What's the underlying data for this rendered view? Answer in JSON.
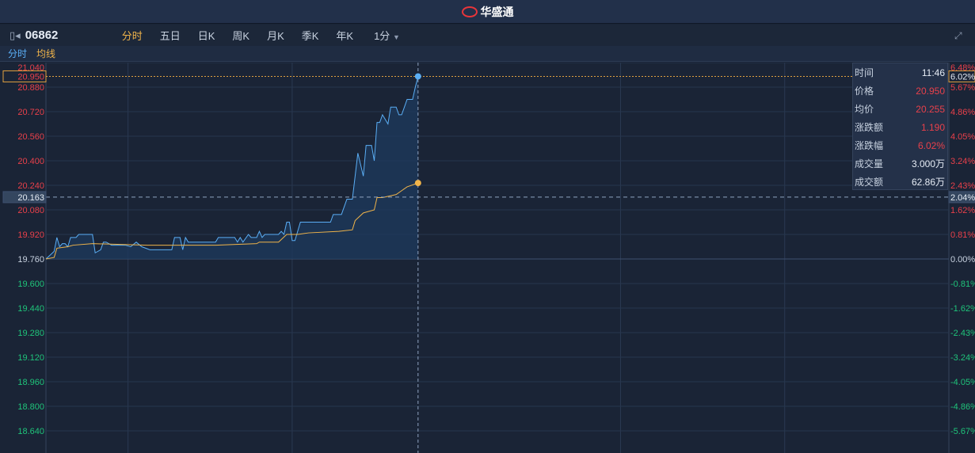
{
  "app": {
    "logo": "华盛通"
  },
  "toolbar": {
    "code": "06862",
    "tabs": [
      "分时",
      "五日",
      "日K",
      "周K",
      "月K",
      "季K",
      "年K"
    ],
    "active_tab": "分时",
    "interval": "1分"
  },
  "subbar": {
    "series": "分时",
    "avg": "均线"
  },
  "info": {
    "rows": [
      {
        "label": "时间",
        "value": "11:46"
      },
      {
        "label": "价格",
        "value": "20.950"
      },
      {
        "label": "均价",
        "value": "20.255"
      },
      {
        "label": "涨跌额",
        "value": "1.190"
      },
      {
        "label": "涨跌幅",
        "value": "6.02%"
      },
      {
        "label": "成交量",
        "value": "3.000万"
      },
      {
        "label": "成交额",
        "value": "62.86万"
      }
    ]
  },
  "colors": {
    "price": "#5aaef5",
    "avg": "#f0b44a",
    "up": "#e8404a",
    "down": "#1fc37a"
  },
  "chart_data": {
    "type": "line",
    "prev_close": 19.76,
    "ylim": [
      18.56,
      21.04
    ],
    "x_minutes_total": 330,
    "y_ticks": [
      "21.040",
      "20.880",
      "20.720",
      "20.560",
      "20.400",
      "20.240",
      "20.080",
      "19.920",
      "19.760",
      "19.600",
      "19.440",
      "19.280",
      "19.120",
      "18.960",
      "18.800",
      "18.640"
    ],
    "pct_ticks": [
      "6.48%",
      "5.67%",
      "4.86%",
      "4.05%",
      "3.24%",
      "2.43%",
      "1.62%",
      "0.81%",
      "0.00%",
      "-0.81%",
      "-1.62%",
      "-2.43%",
      "-3.24%",
      "-4.05%",
      "-4.86%",
      "-5.67%"
    ],
    "cursor": {
      "minute": 136,
      "price_label": "20.950",
      "pct_label": "6.02%"
    },
    "hline": {
      "price": 20.163,
      "price_label": "20.163",
      "pct_label": "2.04%"
    },
    "series": [
      {
        "name": "分时",
        "points": [
          [
            0,
            19.76
          ],
          [
            3,
            19.81
          ],
          [
            4,
            19.9
          ],
          [
            5,
            19.84
          ],
          [
            6,
            19.86
          ],
          [
            7,
            19.86
          ],
          [
            8,
            19.84
          ],
          [
            9,
            19.9
          ],
          [
            11,
            19.9
          ],
          [
            12,
            19.92
          ],
          [
            17,
            19.92
          ],
          [
            18,
            19.8
          ],
          [
            20,
            19.82
          ],
          [
            21,
            19.87
          ],
          [
            22,
            19.87
          ],
          [
            24,
            19.85
          ],
          [
            29,
            19.85
          ],
          [
            31,
            19.84
          ],
          [
            33,
            19.87
          ],
          [
            35,
            19.84
          ],
          [
            38,
            19.82
          ],
          [
            46,
            19.82
          ],
          [
            47,
            19.9
          ],
          [
            49,
            19.9
          ],
          [
            50,
            19.82
          ],
          [
            51,
            19.9
          ],
          [
            52,
            19.87
          ],
          [
            62,
            19.87
          ],
          [
            63,
            19.9
          ],
          [
            69,
            19.9
          ],
          [
            70,
            19.87
          ],
          [
            71,
            19.9
          ],
          [
            72,
            19.87
          ],
          [
            74,
            19.92
          ],
          [
            75,
            19.9
          ],
          [
            77,
            19.9
          ],
          [
            78,
            19.94
          ],
          [
            79,
            19.9
          ],
          [
            80,
            19.92
          ],
          [
            85,
            19.92
          ],
          [
            86,
            19.94
          ],
          [
            87,
            19.92
          ],
          [
            88,
            20.0
          ],
          [
            89,
            20.0
          ],
          [
            90,
            19.88
          ],
          [
            91,
            19.88
          ],
          [
            93,
            20.0
          ],
          [
            104,
            20.0
          ],
          [
            105,
            20.05
          ],
          [
            108,
            20.05
          ],
          [
            110,
            20.15
          ],
          [
            112,
            20.15
          ],
          [
            114,
            20.45
          ],
          [
            116,
            20.3
          ],
          [
            117,
            20.5
          ],
          [
            119,
            20.5
          ],
          [
            120,
            20.4
          ],
          [
            121,
            20.65
          ],
          [
            122,
            20.65
          ],
          [
            123,
            20.7
          ],
          [
            125,
            20.64
          ],
          [
            126,
            20.75
          ],
          [
            128,
            20.75
          ],
          [
            129,
            20.7
          ],
          [
            130,
            20.7
          ],
          [
            132,
            20.8
          ],
          [
            134,
            20.8
          ],
          [
            135,
            20.88
          ],
          [
            136,
            20.95
          ]
        ]
      },
      {
        "name": "均线",
        "points": [
          [
            0,
            19.76
          ],
          [
            3,
            19.77
          ],
          [
            4,
            19.83
          ],
          [
            8,
            19.84
          ],
          [
            10,
            19.85
          ],
          [
            17,
            19.86
          ],
          [
            37,
            19.85
          ],
          [
            62,
            19.85
          ],
          [
            77,
            19.86
          ],
          [
            78,
            19.87
          ],
          [
            85,
            19.87
          ],
          [
            88,
            19.92
          ],
          [
            92,
            19.92
          ],
          [
            96,
            19.93
          ],
          [
            107,
            19.94
          ],
          [
            112,
            19.95
          ],
          [
            113,
            20.01
          ],
          [
            116,
            20.06
          ],
          [
            120,
            20.08
          ],
          [
            121,
            20.16
          ],
          [
            123,
            20.16
          ],
          [
            128,
            20.18
          ],
          [
            132,
            20.23
          ],
          [
            136,
            20.255
          ]
        ]
      }
    ]
  }
}
